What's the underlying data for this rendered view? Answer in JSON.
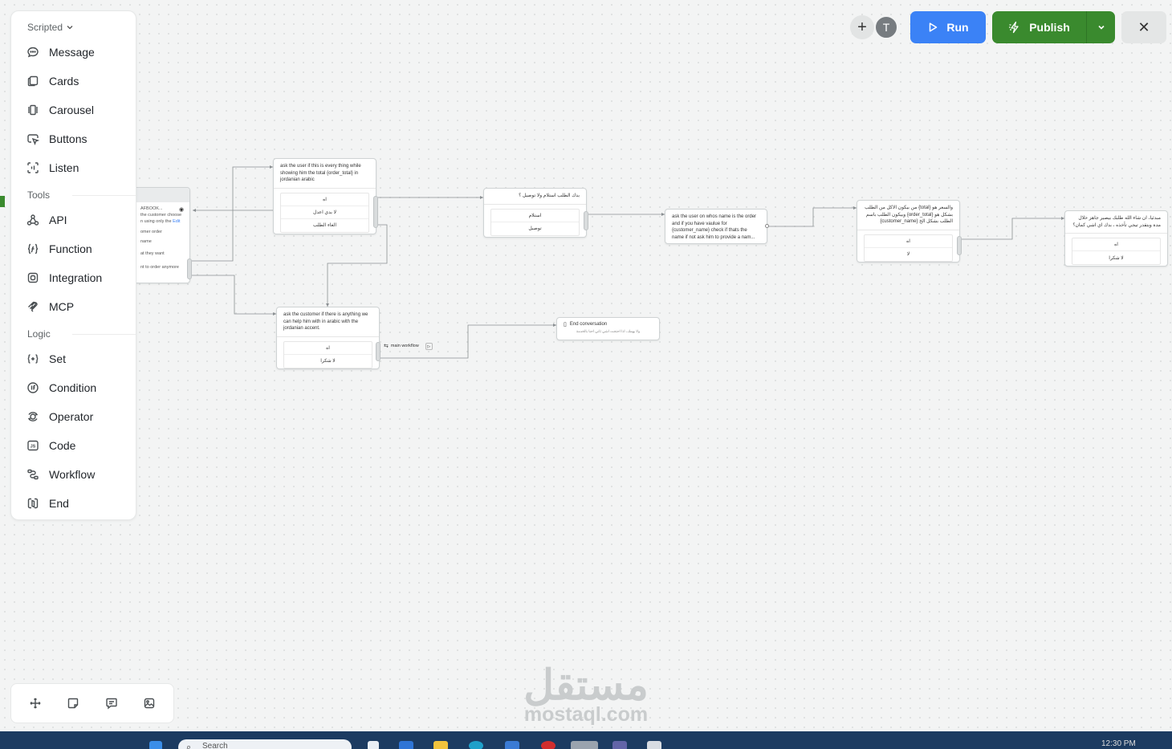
{
  "sidebar": {
    "scripted_label": "Scripted",
    "tools_label": "Tools",
    "logic_label": "Logic",
    "scripted_items": [
      {
        "label": "Message",
        "icon": "message-icon"
      },
      {
        "label": "Cards",
        "icon": "cards-icon"
      },
      {
        "label": "Carousel",
        "icon": "carousel-icon"
      },
      {
        "label": "Buttons",
        "icon": "buttons-icon"
      },
      {
        "label": "Listen",
        "icon": "listen-icon"
      }
    ],
    "tools_items": [
      {
        "label": "API",
        "icon": "api-icon"
      },
      {
        "label": "Function",
        "icon": "function-icon"
      },
      {
        "label": "Integration",
        "icon": "integration-icon"
      },
      {
        "label": "MCP",
        "icon": "mcp-icon"
      }
    ],
    "logic_items": [
      {
        "label": "Set",
        "icon": "set-icon"
      },
      {
        "label": "Condition",
        "icon": "condition-icon"
      },
      {
        "label": "Operator",
        "icon": "operator-icon"
      },
      {
        "label": "Code",
        "icon": "code-icon"
      },
      {
        "label": "Workflow",
        "icon": "workflow-icon"
      },
      {
        "label": "End",
        "icon": "end-icon"
      }
    ]
  },
  "header": {
    "avatar_initial": "T",
    "run_label": "Run",
    "publish_label": "Publish",
    "close_symbol": "✕",
    "plus_symbol": "+"
  },
  "canvas": {
    "partial_node": {
      "lines": [
        "AFBOOK...",
        "the customer choose",
        "n using only the",
        "Edit",
        "omer order",
        "name",
        "at they want",
        "nt to order anymore"
      ]
    },
    "node_confirm": {
      "prompt": "ask the user if this is every thing while showing him the total {order_total} in jordanian arabic",
      "options": [
        "اه",
        "لا بدي اعدل",
        "الغاء الطلب"
      ]
    },
    "node_pickup": {
      "prompt": "بدك الطلب استلام ولا توصيل ؟",
      "options": [
        "استلام",
        "توصيل"
      ]
    },
    "node_name": {
      "prompt": "ask the user on whos name is the order and if you have vaulue for {customer_name} check if thats the name if not ask him to provide a nam..."
    },
    "node_summary": {
      "prompt": "والسعر هو {total} من بيكون الاكل من الطلب بشكل هو {order_total} وبيكون الطلب باسم الطلب بشكل الخ {customer_name}",
      "options": [
        "اه",
        "لا"
      ]
    },
    "node_far_right": {
      "prompt": "مبدئيا، ان شاء الله طلبك بيصير جاهز خلال مدة وبتقدر تيجي تأخذه ، بدك اي اشي كمان؟",
      "options": [
        "اه",
        "لا شكرا"
      ]
    },
    "node_help": {
      "prompt": "ask the customer if there is anything we can help him with in arabic with the jordanian accent.",
      "options": [
        "اه",
        "لا شكرا"
      ]
    },
    "workflow_chip": "main workflow",
    "node_end": {
      "title": "End conversation",
      "subtitle": "ولا يهمك، اذا احتجت اشي ثاني احنا بالخدمة"
    }
  },
  "watermark": {
    "arabic": "مستقل",
    "latin": "mostaql.com"
  },
  "taskbar": {
    "search_placeholder": "Search",
    "clock": "12:30 PM"
  }
}
